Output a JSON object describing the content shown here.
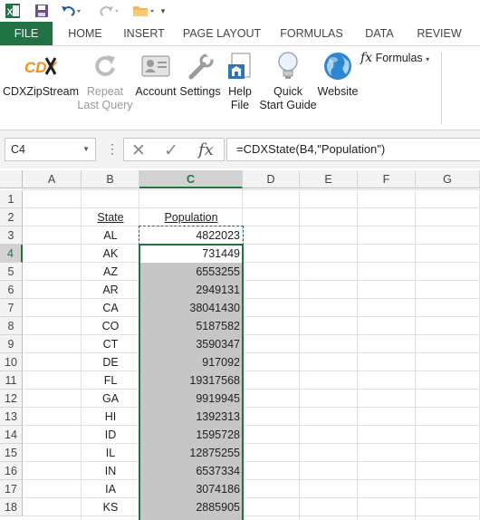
{
  "qat": {
    "excel_icon": "excel-logo-icon",
    "save_icon": "save-icon",
    "undo_icon": "undo-icon",
    "redo_icon": "redo-icon",
    "open_icon": "folder-icon",
    "customize_icon": "customize-qat-icon"
  },
  "tabs": [
    {
      "label": "FILE"
    },
    {
      "label": "HOME"
    },
    {
      "label": "INSERT"
    },
    {
      "label": "PAGE LAYOUT"
    },
    {
      "label": "FORMULAS"
    },
    {
      "label": "DATA"
    },
    {
      "label": "REVIEW"
    }
  ],
  "ribbon": {
    "cdx_logo": "CDX",
    "buttons": [
      {
        "label1": "CDXZipStream",
        "label2": "",
        "icon": "cdx-logo-icon",
        "disabled": false
      },
      {
        "label1": "Repeat",
        "label2": "Last Query",
        "icon": "repeat-icon",
        "disabled": true
      },
      {
        "label1": "Account",
        "label2": "",
        "icon": "account-card-icon",
        "disabled": false
      },
      {
        "label1": "Settings",
        "label2": "",
        "icon": "wrench-icon",
        "disabled": false
      },
      {
        "label1": "Help",
        "label2": "File",
        "icon": "help-file-icon",
        "disabled": false
      },
      {
        "label1": "Quick",
        "label2": "Start Guide",
        "icon": "lightbulb-icon",
        "disabled": false
      },
      {
        "label1": "Website",
        "label2": "",
        "icon": "globe-icon",
        "disabled": false
      }
    ],
    "formulas_label": "Formulas",
    "formulas_icon": "fx-icon"
  },
  "formula_bar": {
    "name_box": "C4",
    "cancel_icon": "cancel-x-icon",
    "enter_icon": "checkmark-icon",
    "fx_label": "fx",
    "formula": "=CDXState(B4,\"Population\")"
  },
  "grid": {
    "columns": [
      "A",
      "B",
      "C",
      "D",
      "E",
      "F",
      "G"
    ],
    "selected_column": "C",
    "selected_row": "4",
    "rows": [
      "1",
      "2",
      "3",
      "4",
      "5",
      "6",
      "7",
      "8",
      "9",
      "10",
      "11",
      "12",
      "13",
      "14",
      "15",
      "16",
      "17",
      "18"
    ],
    "header_state": "State",
    "header_population": "Population",
    "data": [
      {
        "state": "AL",
        "population": "4822023"
      },
      {
        "state": "AK",
        "population": "731449"
      },
      {
        "state": "AZ",
        "population": "6553255"
      },
      {
        "state": "AR",
        "population": "2949131"
      },
      {
        "state": "CA",
        "population": "38041430"
      },
      {
        "state": "CO",
        "population": "5187582"
      },
      {
        "state": "CT",
        "population": "3590347"
      },
      {
        "state": "DE",
        "population": "917092"
      },
      {
        "state": "FL",
        "population": "19317568"
      },
      {
        "state": "GA",
        "population": "9919945"
      },
      {
        "state": "HI",
        "population": "1392313"
      },
      {
        "state": "ID",
        "population": "1595728"
      },
      {
        "state": "IL",
        "population": "12875255"
      },
      {
        "state": "IN",
        "population": "6537334"
      },
      {
        "state": "IA",
        "population": "3074186"
      },
      {
        "state": "KS",
        "population": "2885905"
      }
    ]
  },
  "colors": {
    "accent": "#217346",
    "selection": "#c6c6c6"
  }
}
